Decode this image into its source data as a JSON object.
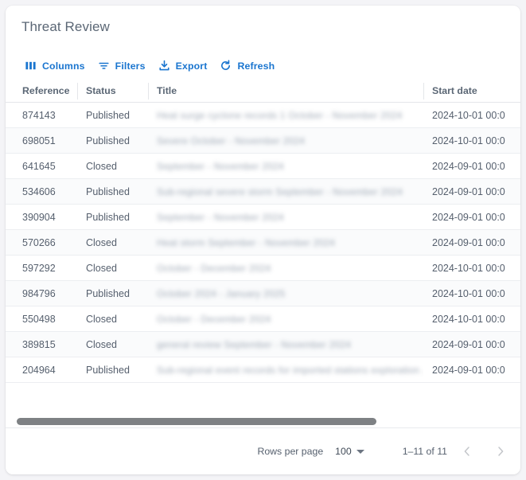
{
  "card": {
    "title": "Threat Review"
  },
  "toolbar": {
    "buttons": [
      {
        "label": "Columns",
        "icon": "columns-icon"
      },
      {
        "label": "Filters",
        "icon": "filters-icon"
      },
      {
        "label": "Export",
        "icon": "export-icon"
      },
      {
        "label": "Refresh",
        "icon": "refresh-icon"
      }
    ],
    "accent_color": "#1a75cf"
  },
  "table": {
    "columns": [
      {
        "key": "reference",
        "label": "Reference"
      },
      {
        "key": "status",
        "label": "Status"
      },
      {
        "key": "title",
        "label": "Title"
      },
      {
        "key": "start_date",
        "label": "Start date"
      }
    ],
    "rows": [
      {
        "reference": "874143",
        "status": "Published",
        "title": "Heat surge cyclone records 1 October - November 2024",
        "start_date": "2024-10-01 00:0"
      },
      {
        "reference": "698051",
        "status": "Published",
        "title": "Severe October - November 2024",
        "start_date": "2024-10-01 00:0"
      },
      {
        "reference": "641645",
        "status": "Closed",
        "title": "September - November 2024",
        "start_date": "2024-09-01 00:0"
      },
      {
        "reference": "534606",
        "status": "Published",
        "title": "Sub-regional severe storm September - November 2024",
        "start_date": "2024-09-01 00:0"
      },
      {
        "reference": "390904",
        "status": "Published",
        "title": "September - November 2024",
        "start_date": "2024-09-01 00:0"
      },
      {
        "reference": "570266",
        "status": "Closed",
        "title": "Heat storm September - November 2024",
        "start_date": "2024-09-01 00:0"
      },
      {
        "reference": "597292",
        "status": "Closed",
        "title": "October - December 2024",
        "start_date": "2024-10-01 00:0"
      },
      {
        "reference": "984796",
        "status": "Published",
        "title": "October 2024 - January 2025",
        "start_date": "2024-10-01 00:0"
      },
      {
        "reference": "550498",
        "status": "Closed",
        "title": "October - December 2024",
        "start_date": "2024-10-01 00:0"
      },
      {
        "reference": "389815",
        "status": "Closed",
        "title": "general review September - November 2024",
        "start_date": "2024-09-01 00:0"
      },
      {
        "reference": "204964",
        "status": "Published",
        "title": "Sub-regional event records for imported stations exploration ...",
        "start_date": "2024-09-01 00:0"
      }
    ],
    "title_redacted": true
  },
  "scrollbar": {
    "orientation": "horizontal"
  },
  "pagination": {
    "rows_per_page_label": "Rows per page",
    "rows_per_page_value": "100",
    "range_label": "1–11 of 11",
    "prev_label": "Go to previous page",
    "next_label": "Go to next page"
  }
}
